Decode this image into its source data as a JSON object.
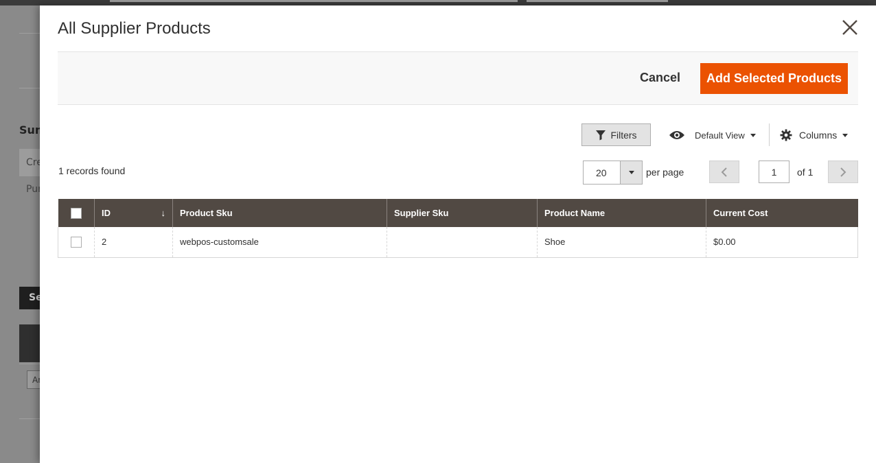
{
  "background": {
    "text_sum": "Sum",
    "tab_label": "Cre",
    "purch_label": "Pur",
    "dark_btn_label": "Se",
    "input_text": "Ar"
  },
  "modal": {
    "title": "All Supplier Products",
    "cancel_label": "Cancel",
    "add_label": "Add Selected Products"
  },
  "toolbar": {
    "filters_label": "Filters",
    "view_label": "Default View",
    "columns_label": "Columns"
  },
  "records_found": "1 records found",
  "pagination": {
    "per_page_value": "20",
    "per_page_label": "per page",
    "current_page": "1",
    "total_label": "of 1"
  },
  "grid": {
    "headers": [
      "ID",
      "Product Sku",
      "Supplier Sku",
      "Product Name",
      "Current Cost"
    ],
    "sort_indicator": "↓",
    "rows": [
      {
        "id": "2",
        "product_sku": "webpos-customsale",
        "supplier_sku": "",
        "product_name": "Shoe",
        "current_cost": "$0.00"
      }
    ]
  },
  "colors": {
    "accent": "#eb5202",
    "header_bg": "#514943"
  },
  "icons": {
    "close": "close-icon",
    "filter": "funnel-icon",
    "view": "eye-icon",
    "columns": "gear-icon",
    "dropdown": "caret-down-icon",
    "prev": "chevron-left-icon",
    "next": "chevron-right-icon"
  }
}
